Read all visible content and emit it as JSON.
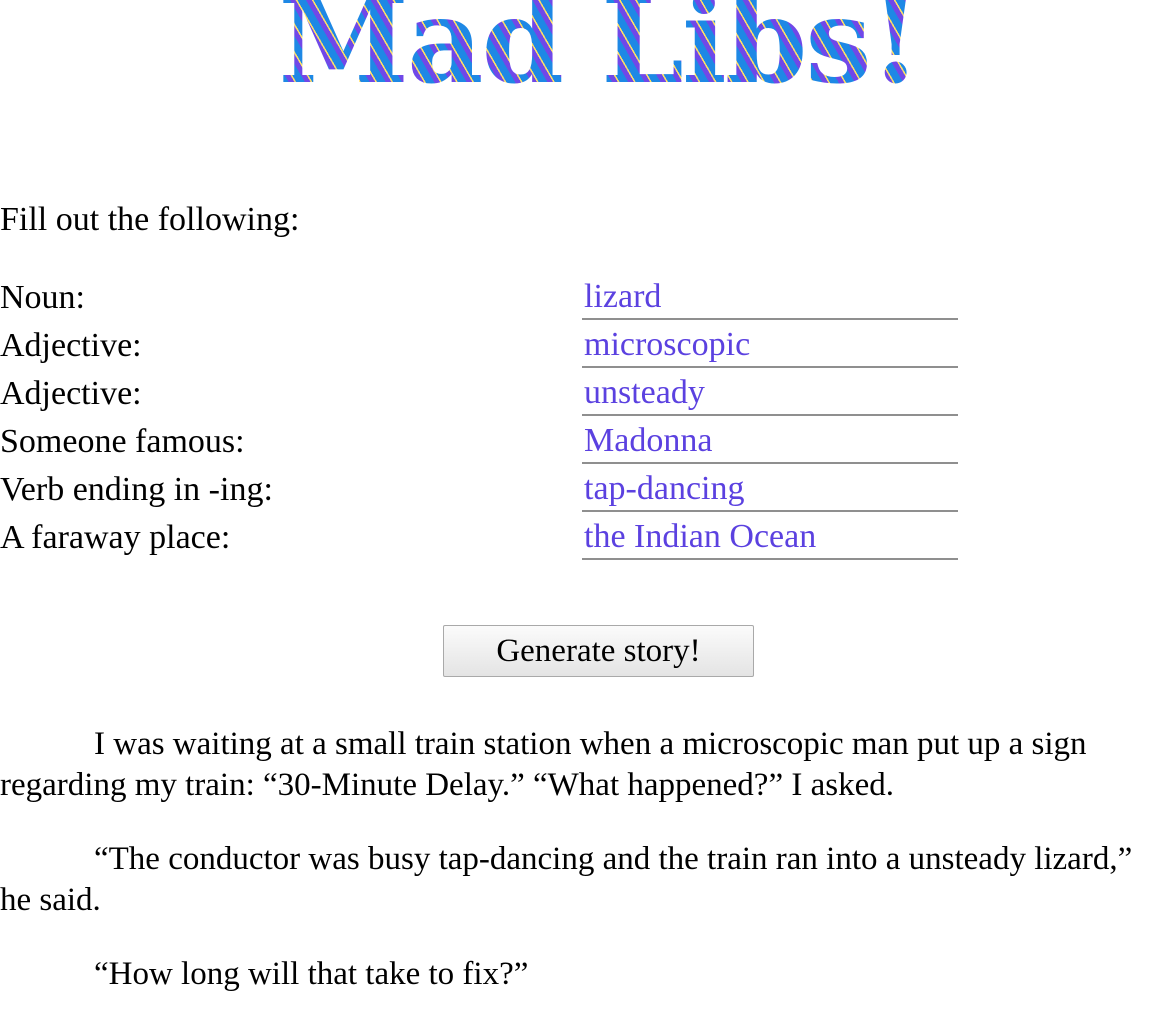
{
  "header": {
    "title": "Mad Libs!"
  },
  "form": {
    "intro": "Fill out the following:",
    "fields": [
      {
        "label": "Noun:",
        "value": "lizard"
      },
      {
        "label": "Adjective:",
        "value": "microscopic"
      },
      {
        "label": "Adjective:",
        "value": "unsteady"
      },
      {
        "label": "Someone famous:",
        "value": "Madonna"
      },
      {
        "label": "Verb ending in -ing:",
        "value": "tap-dancing"
      },
      {
        "label": "A faraway place:",
        "value": "the Indian Ocean"
      }
    ],
    "generate_label": "Generate story!"
  },
  "story": {
    "paragraphs": [
      "I was waiting at a small train station when a microscopic man put up a sign regarding my train: “30-Minute Delay.” “What happened?” I asked.",
      "“The conductor was busy tap-dancing and the train ran into a unsteady lizard,” he said.",
      "“How long will that take to fix?”"
    ]
  },
  "colors": {
    "input_text": "#5b41e0",
    "title_stripe_blue": "#1e88e5",
    "title_stripe_purple": "#7048e8",
    "title_stripe_yellow": "#ffe066"
  }
}
